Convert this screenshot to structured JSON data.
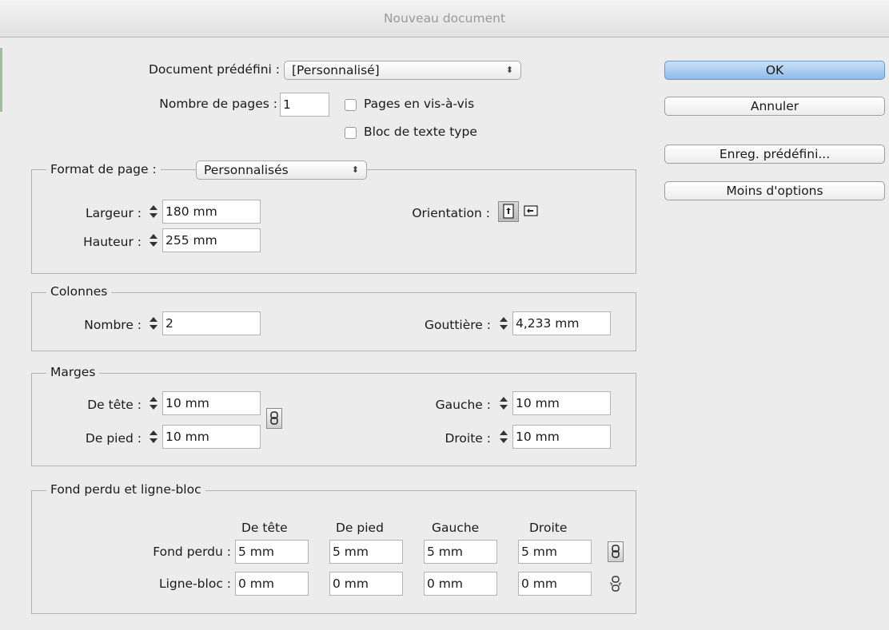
{
  "window": {
    "title": "Nouveau document"
  },
  "top": {
    "preset_label": "Document prédéfini :",
    "preset_value": "[Personnalisé]",
    "pages_label": "Nombre de pages :",
    "pages_value": "1",
    "facing_label": "Pages en vis-à-vis",
    "textframe_label": "Bloc de texte type"
  },
  "buttons": {
    "ok": "OK",
    "cancel": "Annuler",
    "save_preset": "Enreg. prédéfini...",
    "fewer_options": "Moins d'options"
  },
  "page_size": {
    "label": "Format de page :",
    "value": "Personnalisés",
    "width_label": "Largeur :",
    "width_value": "180 mm",
    "height_label": "Hauteur :",
    "height_value": "255 mm",
    "orientation_label": "Orientation :"
  },
  "columns": {
    "title": "Colonnes",
    "number_label": "Nombre :",
    "number_value": "2",
    "gutter_label": "Gouttière :",
    "gutter_value": "4,233 mm"
  },
  "margins": {
    "title": "Marges",
    "top_label": "De tête :",
    "top_value": "10 mm",
    "bottom_label": "De pied :",
    "bottom_value": "10 mm",
    "left_label": "Gauche :",
    "left_value": "10 mm",
    "right_label": "Droite :",
    "right_value": "10 mm"
  },
  "bleed": {
    "title": "Fond perdu et ligne-bloc",
    "headers": [
      "De tête",
      "De pied",
      "Gauche",
      "Droite"
    ],
    "bleed_label": "Fond perdu :",
    "bleed_values": [
      "5 mm",
      "5 mm",
      "5 mm",
      "5 mm"
    ],
    "slug_label": "Ligne-bloc :",
    "slug_values": [
      "0 mm",
      "0 mm",
      "0 mm",
      "0 mm"
    ]
  },
  "icons": {
    "chain": "chain-link-icon",
    "orientation_portrait": "portrait-icon",
    "orientation_landscape": "landscape-icon",
    "unlinked": "chain-broken-icon"
  }
}
